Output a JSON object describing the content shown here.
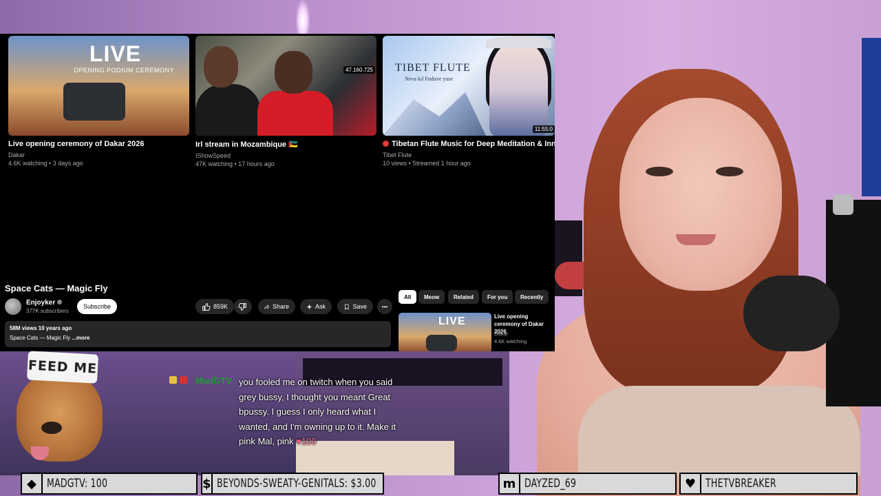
{
  "recommended": [
    {
      "title": "Live opening ceremony of Dakar 2026",
      "channel": "Dakar",
      "meta": "4.6K watching • 3 days ago",
      "thumb_text": "LIVE",
      "thumb_subtext": "OPENING PODIUM CEREMONY"
    },
    {
      "title": "Irl stream in Mozambique 🇲🇿",
      "channel": "IShowSpeed",
      "meta": "47K watching • 17 hours ago",
      "badge": "47.160.725"
    },
    {
      "title": "Tibetan Flute Music for Deep Meditation & Inner Pea",
      "channel": "Tibet Flute",
      "meta": "10 views • Streamed 1 hour ago",
      "thumb_text": "TIBET FLUTE",
      "thumb_subtext": "Neva kıl Fnduve yuse",
      "badge": "11:55:0"
    }
  ],
  "video": {
    "title": "Space Cats — Magic Fly",
    "channel": "Enjoyker",
    "subscribers": "377K subscribers",
    "subscribe_label": "Subscribe",
    "likes": "859K",
    "share_label": "Share",
    "ask_label": "Ask",
    "save_label": "Save",
    "more_label": "•••",
    "views_line": "58M views  10 years ago",
    "desc_text": "Space Cats — Magic Fly",
    "desc_more": "...more"
  },
  "chips": [
    "All",
    "Meow",
    "Related",
    "For you",
    "Recently"
  ],
  "side_rec": {
    "title": "Live opening ceremony of Dakar 2026",
    "channel": "Dakar",
    "meta": "4.6K watching",
    "thumb_text": "LIVE"
  },
  "overlay": {
    "hat_text": "FEED ME",
    "chat": {
      "username": "MadGTV",
      "message": "you fooled me on twitch when you said grey bussy, I thought you meant Great bpussy. I guess I only heard what I wanted, and I'm owning up to it. Make it pink Mal, pink",
      "amount": "100",
      "username_color": "#1f9a33"
    },
    "bars": [
      {
        "icon": "diamond-icon",
        "glyph": "◆",
        "text": "MADGTV: 100"
      },
      {
        "icon": "dollar-icon",
        "glyph": "$",
        "text": "BEYONDS-SWEATY-GENITALS: $3.00"
      },
      {
        "icon": "m-logo-icon",
        "glyph": "m",
        "text": "DAYZED_69"
      },
      {
        "icon": "heart-icon",
        "glyph": "♥",
        "text": "THETVBREAKER"
      }
    ]
  }
}
